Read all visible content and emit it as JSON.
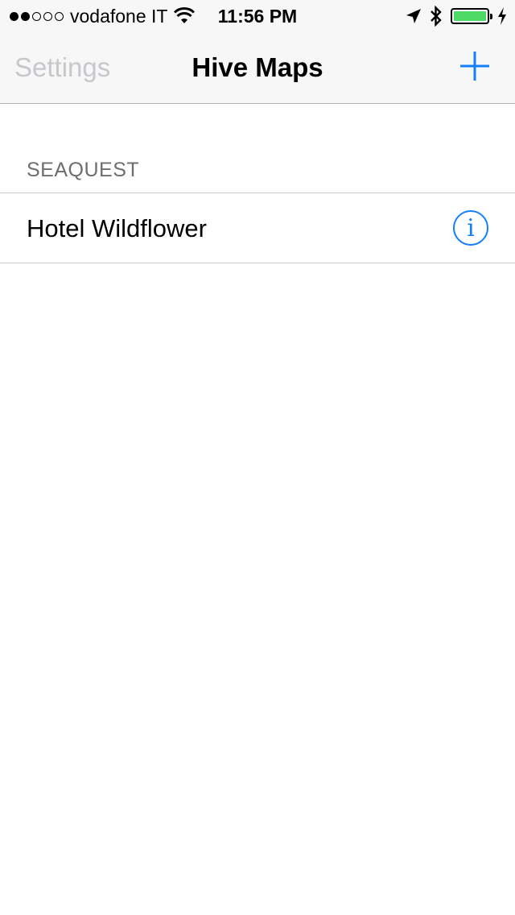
{
  "status_bar": {
    "signal_dots_filled": 2,
    "signal_dots_total": 5,
    "carrier": "vodafone IT",
    "time": "11:56 PM",
    "battery_color": "#4cd964",
    "icons": [
      "wifi-icon",
      "location-arrow-icon",
      "bluetooth-icon",
      "battery-icon",
      "charging-bolt-icon"
    ]
  },
  "navbar": {
    "left_button": "Settings",
    "title": "Hive Maps",
    "right_button_icon": "plus-icon"
  },
  "section": {
    "header": "SEAQUEST",
    "items": [
      {
        "label": "Hotel Wildflower",
        "accessory_icon": "info-icon"
      }
    ]
  },
  "colors": {
    "accent": "#147efb",
    "disabled_text": "#c7c7cc"
  }
}
